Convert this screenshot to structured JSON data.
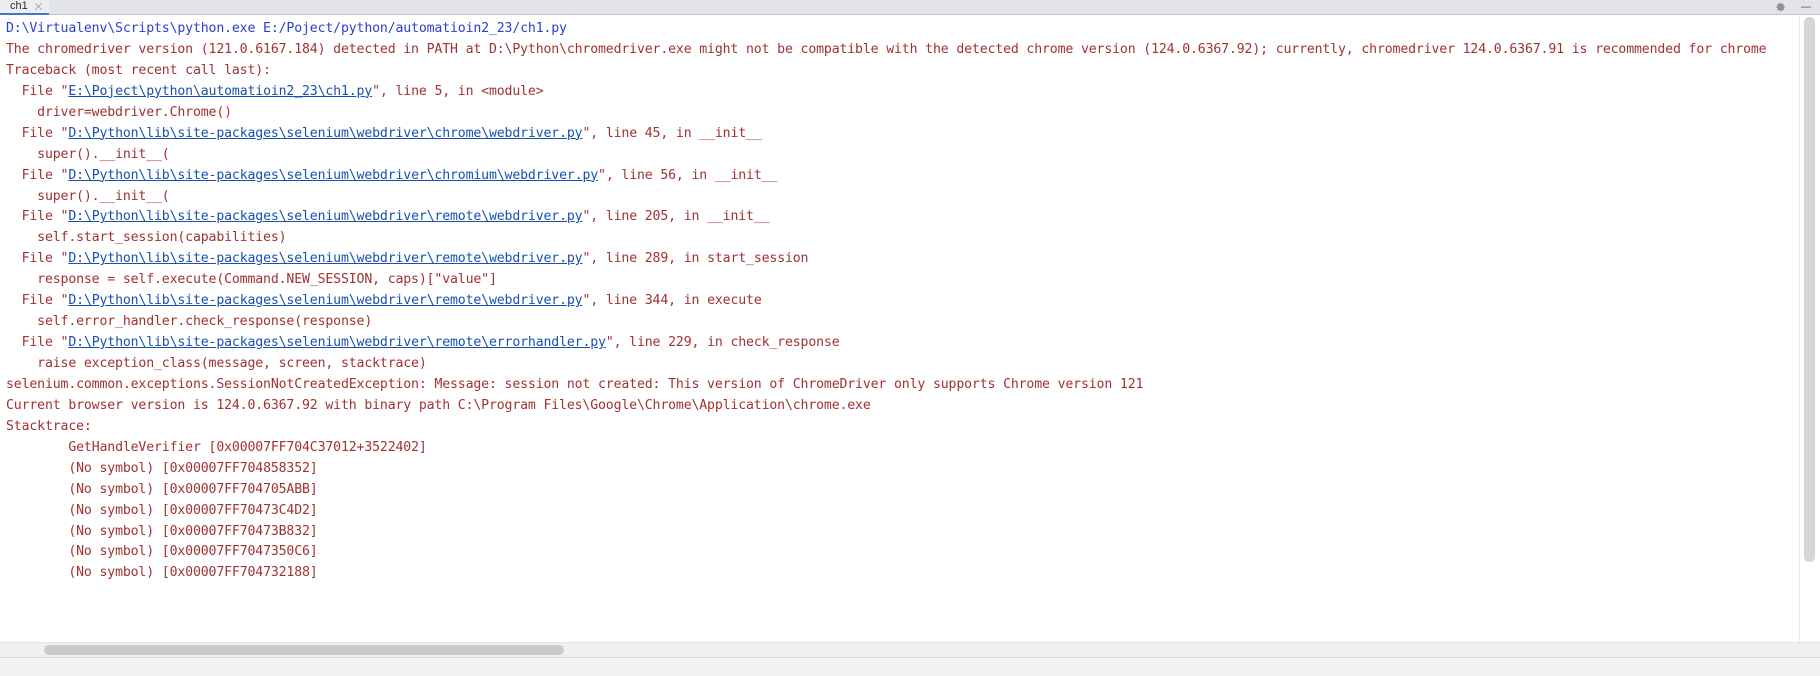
{
  "window": {
    "tab": {
      "label": "ch1",
      "close_icon": "close-icon"
    },
    "tab_actions": [
      {
        "icon": "settings-gear-icon"
      },
      {
        "icon": "minimize-icon"
      }
    ]
  },
  "console": {
    "lines": [
      {
        "type": "cmd",
        "text": "D:\\Virtualenv\\Scripts\\python.exe E:/Poject/python/automatioin2_23/ch1.py"
      },
      {
        "type": "err",
        "text": "The chromedriver version (121.0.6167.184) detected in PATH at D:\\Python\\chromedriver.exe might not be compatible with the detected chrome version (124.0.6367.92); currently, chromedriver 124.0.6367.91 is recommended for chrome"
      },
      {
        "type": "err",
        "text": "Traceback (most recent call last):"
      },
      {
        "type": "file",
        "pre": "  File \"",
        "link": "E:\\Poject\\python\\automatioin2_23\\ch1.py",
        "post": "\", line 5, in <module>"
      },
      {
        "type": "err",
        "text": "    driver=webdriver.Chrome()"
      },
      {
        "type": "file",
        "pre": "  File \"",
        "link": "D:\\Python\\lib\\site-packages\\selenium\\webdriver\\chrome\\webdriver.py",
        "post": "\", line 45, in __init__"
      },
      {
        "type": "err",
        "text": "    super().__init__("
      },
      {
        "type": "file",
        "pre": "  File \"",
        "link": "D:\\Python\\lib\\site-packages\\selenium\\webdriver\\chromium\\webdriver.py",
        "post": "\", line 56, in __init__"
      },
      {
        "type": "err",
        "text": "    super().__init__("
      },
      {
        "type": "file",
        "pre": "  File \"",
        "link": "D:\\Python\\lib\\site-packages\\selenium\\webdriver\\remote\\webdriver.py",
        "post": "\", line 205, in __init__"
      },
      {
        "type": "err",
        "text": "    self.start_session(capabilities)"
      },
      {
        "type": "file",
        "pre": "  File \"",
        "link": "D:\\Python\\lib\\site-packages\\selenium\\webdriver\\remote\\webdriver.py",
        "post": "\", line 289, in start_session"
      },
      {
        "type": "err",
        "text": "    response = self.execute(Command.NEW_SESSION, caps)[\"value\"]"
      },
      {
        "type": "file",
        "pre": "  File \"",
        "link": "D:\\Python\\lib\\site-packages\\selenium\\webdriver\\remote\\webdriver.py",
        "post": "\", line 344, in execute"
      },
      {
        "type": "err",
        "text": "    self.error_handler.check_response(response)"
      },
      {
        "type": "file",
        "pre": "  File \"",
        "link": "D:\\Python\\lib\\site-packages\\selenium\\webdriver\\remote\\errorhandler.py",
        "post": "\", line 229, in check_response"
      },
      {
        "type": "err",
        "text": "    raise exception_class(message, screen, stacktrace)"
      },
      {
        "type": "err",
        "text": "selenium.common.exceptions.SessionNotCreatedException: Message: session not created: This version of ChromeDriver only supports Chrome version 121"
      },
      {
        "type": "err",
        "text": "Current browser version is 124.0.6367.92 with binary path C:\\Program Files\\Google\\Chrome\\Application\\chrome.exe"
      },
      {
        "type": "err",
        "text": "Stacktrace:"
      },
      {
        "type": "err",
        "text": "\tGetHandleVerifier [0x00007FF704C37012+3522402]"
      },
      {
        "type": "err",
        "text": "\t(No symbol) [0x00007FF704858352]"
      },
      {
        "type": "err",
        "text": "\t(No symbol) [0x00007FF704705ABB]"
      },
      {
        "type": "err",
        "text": "\t(No symbol) [0x00007FF70473C4D2]"
      },
      {
        "type": "err",
        "text": "\t(No symbol) [0x00007FF70473B832]"
      },
      {
        "type": "err",
        "text": "\t(No symbol) [0x00007FF7047350C6]"
      },
      {
        "type": "err",
        "text": "\t(No symbol) [0x00007FF704732188]"
      }
    ]
  },
  "colors": {
    "command": "#2b40d0",
    "error": "#a03232",
    "link": "#1750b0",
    "tab_active_underline": "#3c79c8",
    "tabstrip_bg": "#e2e4ea",
    "statusbar_bg": "#f2f2f4"
  },
  "scrollbars": {
    "vertical_icon": "vertical-scrollbar",
    "horizontal_icon": "horizontal-scrollbar"
  },
  "statusbar": {
    "items": []
  }
}
